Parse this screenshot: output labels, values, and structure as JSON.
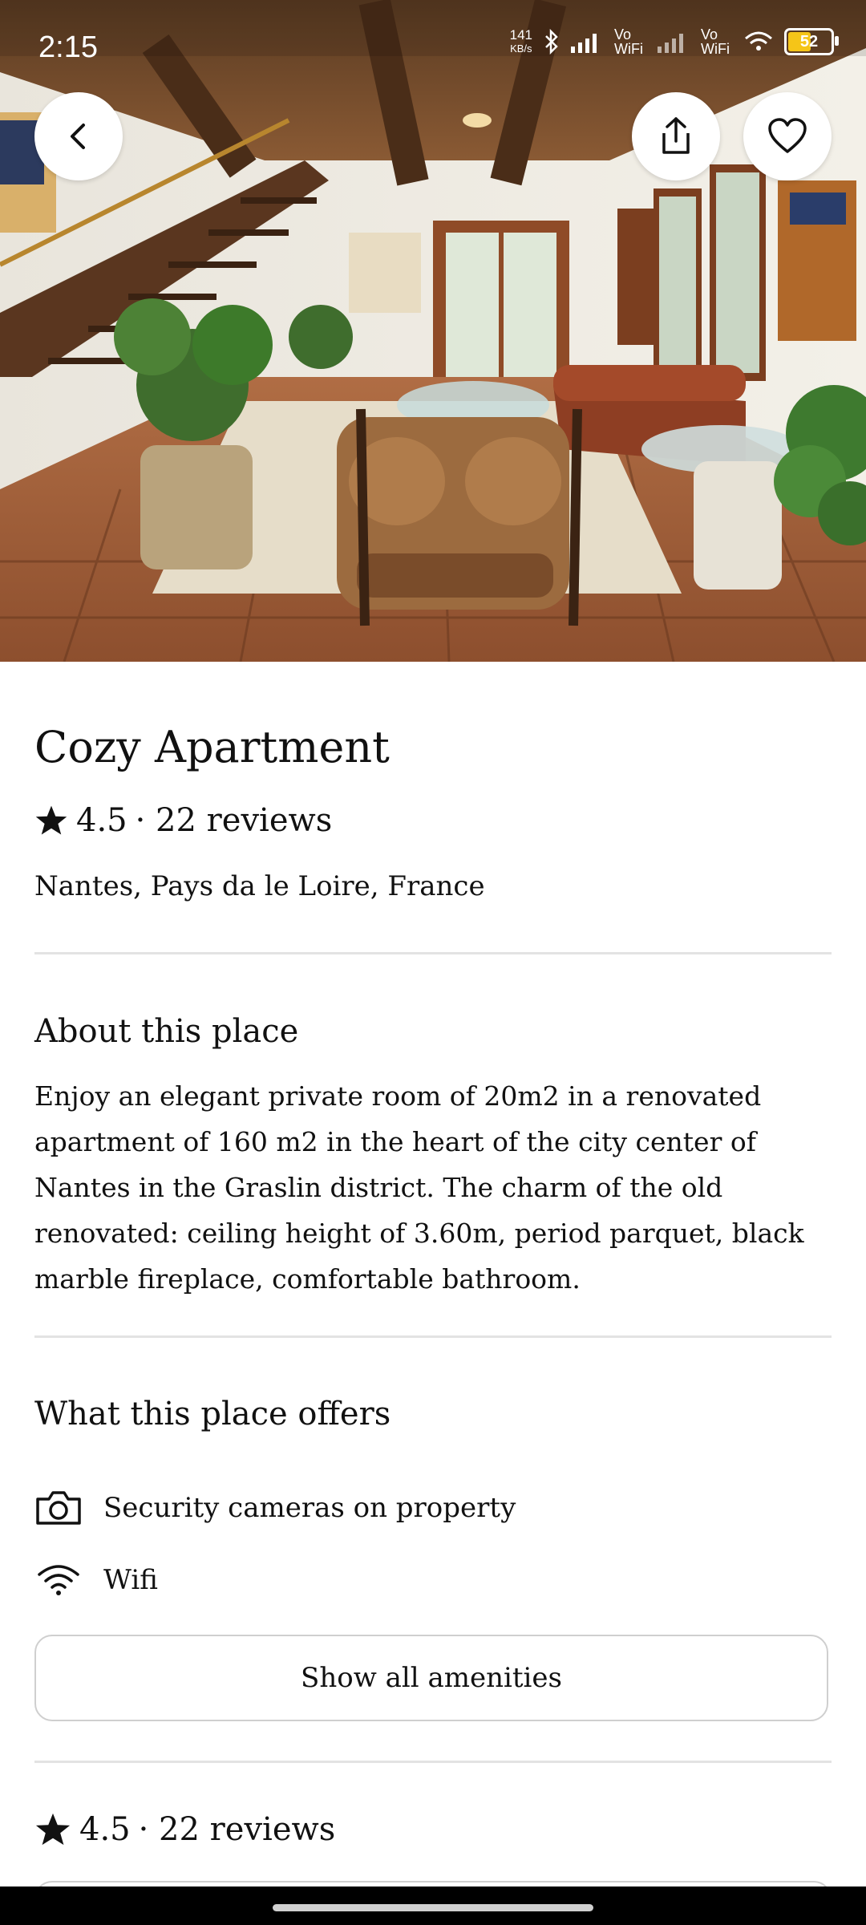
{
  "status_bar": {
    "time": "2:15",
    "net_speed_value": "141",
    "net_speed_unit": "KB/s",
    "vowifi_1": "Vo WiFi",
    "vowifi_2": "Vo WiFi",
    "battery_level": "52"
  },
  "listing": {
    "title": "Cozy Apartment",
    "rating": "4.5",
    "reviews_text": "· 22 reviews",
    "location": "Nantes, Pays da le Loire, France"
  },
  "about": {
    "heading": "About this place",
    "text": "Enjoy an elegant private room of 20m2 in a renovated apartment of 160 m2 in the heart of the city center of Nantes in the Graslin district. The charm of the old renovated: ceiling height of 3.60m, period parquet, black marble fireplace, comfortable bathroom."
  },
  "offers": {
    "heading": "What this place offers",
    "items": [
      {
        "label": "Security cameras on property",
        "icon": "camera-icon"
      },
      {
        "label": "Wifi",
        "icon": "wifi-icon"
      }
    ],
    "show_all_label": "Show all amenities"
  },
  "reviews_section": {
    "rating": "4.5",
    "reviews_text": "· 22 reviews"
  },
  "colors": {
    "background": "#ffffff",
    "text": "#111111",
    "divider": "#e3e3e3",
    "battery_fill": "#f5c518"
  }
}
